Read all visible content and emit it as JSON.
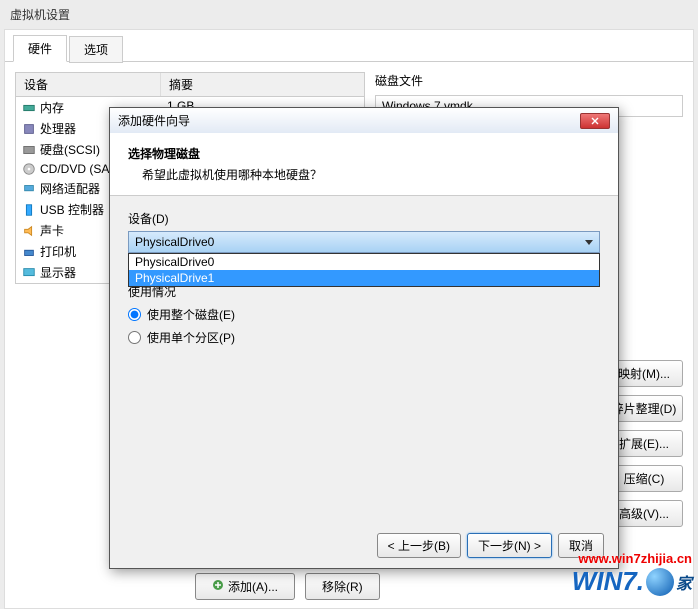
{
  "window": {
    "title": "虚拟机设置"
  },
  "tabs": {
    "hardware": "硬件",
    "options": "选项"
  },
  "deviceList": {
    "headers": {
      "device": "设备",
      "summary": "摘要"
    },
    "rows": [
      {
        "name": "内存",
        "summary": "1 GB"
      },
      {
        "name": "处理器",
        "summary": ""
      },
      {
        "name": "硬盘(SCSI)",
        "summary": ""
      },
      {
        "name": "CD/DVD (SA",
        "summary": ""
      },
      {
        "name": "网络适配器",
        "summary": ""
      },
      {
        "name": "USB 控制器",
        "summary": ""
      },
      {
        "name": "声卡",
        "summary": ""
      },
      {
        "name": "打印机",
        "summary": ""
      },
      {
        "name": "显示器",
        "summary": ""
      }
    ]
  },
  "rightPanel": {
    "diskFileLabel": "磁盘文件",
    "diskFileValue": "Windows 7.vmdk"
  },
  "sideButtons": {
    "map": "映射(M)...",
    "defrag": "碎片整理(D)",
    "expand": "扩展(E)...",
    "compress": "压缩(C)",
    "advanced": "高级(V)..."
  },
  "bottomButtons": {
    "add": "添加(A)...",
    "remove": "移除(R)"
  },
  "dialog": {
    "title": "添加硬件向导",
    "headerTitle": "选择物理磁盘",
    "headerSub": "希望此虚拟机使用哪种本地硬盘？",
    "deviceLabel": "设备(D)",
    "comboSelected": "PhysicalDrive0",
    "comboOptions": [
      "PhysicalDrive0",
      "PhysicalDrive1"
    ],
    "usageLabel": "使用情况",
    "radioWhole": "使用整个磁盘(E)",
    "radioPartition": "使用单个分区(P)",
    "back": "< 上一步(B)",
    "next": "下一步(N) >",
    "cancel": "取消"
  },
  "watermark": {
    "url": "www.win7zhijia.cn",
    "brand1": "WIN",
    "brand2": "7.",
    "brand3": "家"
  }
}
